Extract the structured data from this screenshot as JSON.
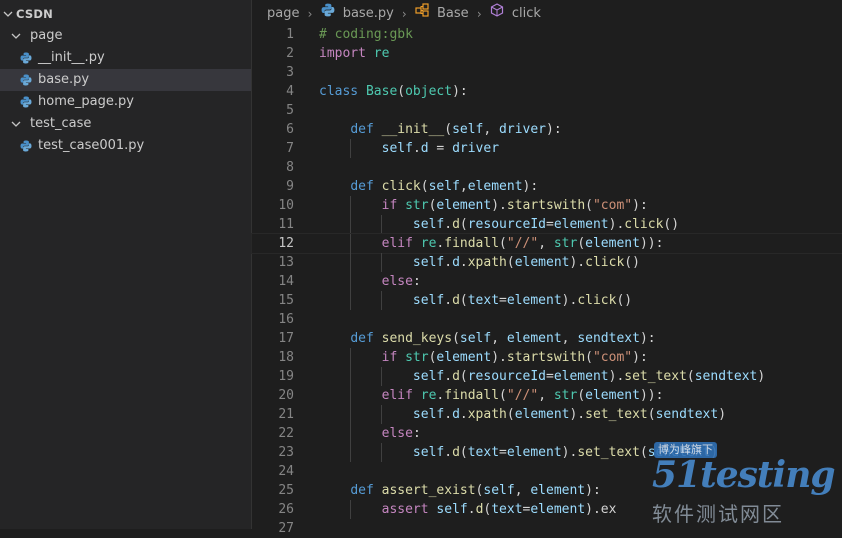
{
  "explorer": {
    "root": "CSDN",
    "items": [
      {
        "label": "page",
        "kind": "folder",
        "depth": 1,
        "expanded": true
      },
      {
        "label": "__init__.py",
        "kind": "python-file",
        "depth": 2
      },
      {
        "label": "base.py",
        "kind": "python-file",
        "depth": 2,
        "selected": true
      },
      {
        "label": "home_page.py",
        "kind": "python-file",
        "depth": 2
      },
      {
        "label": "test_case",
        "kind": "folder",
        "depth": 1,
        "expanded": true
      },
      {
        "label": "test_case001.py",
        "kind": "python-file",
        "depth": 2
      }
    ]
  },
  "breadcrumb": {
    "folder": "page",
    "file": "base.py",
    "class_name": "Base",
    "method": "click"
  },
  "editor": {
    "active_line": 12,
    "lines": [
      {
        "n": "1",
        "indent": 0,
        "tokens": [
          [
            "cmt",
            "# coding:gbk"
          ]
        ]
      },
      {
        "n": "2",
        "indent": 0,
        "tokens": [
          [
            "ctl",
            "import"
          ],
          [
            "plain",
            " "
          ],
          [
            "cls",
            "re"
          ]
        ]
      },
      {
        "n": "3",
        "indent": 0,
        "tokens": []
      },
      {
        "n": "4",
        "indent": 0,
        "tokens": [
          [
            "kw",
            "class"
          ],
          [
            "plain",
            " "
          ],
          [
            "cls",
            "Base"
          ],
          [
            "plain",
            "("
          ],
          [
            "cls",
            "object"
          ],
          [
            "plain",
            "):"
          ]
        ]
      },
      {
        "n": "5",
        "indent": 0,
        "tokens": []
      },
      {
        "n": "6",
        "indent": 1,
        "tokens": [
          [
            "plain",
            "    "
          ],
          [
            "kw",
            "def"
          ],
          [
            "plain",
            " "
          ],
          [
            "fn",
            "__init__"
          ],
          [
            "plain",
            "("
          ],
          [
            "var",
            "self"
          ],
          [
            "plain",
            ", "
          ],
          [
            "var",
            "driver"
          ],
          [
            "plain",
            "):"
          ]
        ]
      },
      {
        "n": "7",
        "indent": 2,
        "tokens": [
          [
            "plain",
            "        "
          ],
          [
            "var",
            "self"
          ],
          [
            "plain",
            "."
          ],
          [
            "var",
            "d"
          ],
          [
            "plain",
            " = "
          ],
          [
            "var",
            "driver"
          ]
        ]
      },
      {
        "n": "8",
        "indent": 0,
        "tokens": []
      },
      {
        "n": "9",
        "indent": 1,
        "tokens": [
          [
            "plain",
            "    "
          ],
          [
            "kw",
            "def"
          ],
          [
            "plain",
            " "
          ],
          [
            "fn",
            "click"
          ],
          [
            "plain",
            "("
          ],
          [
            "var",
            "self"
          ],
          [
            "plain",
            ","
          ],
          [
            "var",
            "element"
          ],
          [
            "plain",
            "):"
          ]
        ]
      },
      {
        "n": "10",
        "indent": 2,
        "tokens": [
          [
            "plain",
            "        "
          ],
          [
            "ctl",
            "if"
          ],
          [
            "plain",
            " "
          ],
          [
            "cls",
            "str"
          ],
          [
            "plain",
            "("
          ],
          [
            "var",
            "element"
          ],
          [
            "plain",
            ")."
          ],
          [
            "fn",
            "startswith"
          ],
          [
            "plain",
            "("
          ],
          [
            "str",
            "\"com\""
          ],
          [
            "plain",
            "):"
          ]
        ]
      },
      {
        "n": "11",
        "indent": 3,
        "tokens": [
          [
            "plain",
            "            "
          ],
          [
            "var",
            "self"
          ],
          [
            "plain",
            "."
          ],
          [
            "fn",
            "d"
          ],
          [
            "plain",
            "("
          ],
          [
            "var",
            "resourceId"
          ],
          [
            "plain",
            "="
          ],
          [
            "var",
            "element"
          ],
          [
            "plain",
            ")."
          ],
          [
            "fn",
            "click"
          ],
          [
            "plain",
            "()"
          ]
        ]
      },
      {
        "n": "12",
        "indent": 2,
        "tokens": [
          [
            "plain",
            "        "
          ],
          [
            "ctl",
            "elif"
          ],
          [
            "plain",
            " "
          ],
          [
            "cls",
            "re"
          ],
          [
            "plain",
            "."
          ],
          [
            "fn",
            "findall"
          ],
          [
            "plain",
            "("
          ],
          [
            "str",
            "\"//\""
          ],
          [
            "plain",
            ", "
          ],
          [
            "cls",
            "str"
          ],
          [
            "plain",
            "("
          ],
          [
            "var",
            "element"
          ],
          [
            "plain",
            ")):"
          ]
        ]
      },
      {
        "n": "13",
        "indent": 3,
        "tokens": [
          [
            "plain",
            "            "
          ],
          [
            "var",
            "self"
          ],
          [
            "plain",
            "."
          ],
          [
            "var",
            "d"
          ],
          [
            "plain",
            "."
          ],
          [
            "fn",
            "xpath"
          ],
          [
            "plain",
            "("
          ],
          [
            "var",
            "element"
          ],
          [
            "plain",
            ")."
          ],
          [
            "fn",
            "click"
          ],
          [
            "plain",
            "()"
          ]
        ]
      },
      {
        "n": "14",
        "indent": 2,
        "tokens": [
          [
            "plain",
            "        "
          ],
          [
            "ctl",
            "else"
          ],
          [
            "plain",
            ":"
          ]
        ]
      },
      {
        "n": "15",
        "indent": 3,
        "tokens": [
          [
            "plain",
            "            "
          ],
          [
            "var",
            "self"
          ],
          [
            "plain",
            "."
          ],
          [
            "fn",
            "d"
          ],
          [
            "plain",
            "("
          ],
          [
            "var",
            "text"
          ],
          [
            "plain",
            "="
          ],
          [
            "var",
            "element"
          ],
          [
            "plain",
            ")."
          ],
          [
            "fn",
            "click"
          ],
          [
            "plain",
            "()"
          ]
        ]
      },
      {
        "n": "16",
        "indent": 0,
        "tokens": []
      },
      {
        "n": "17",
        "indent": 1,
        "tokens": [
          [
            "plain",
            "    "
          ],
          [
            "kw",
            "def"
          ],
          [
            "plain",
            " "
          ],
          [
            "fn",
            "send_keys"
          ],
          [
            "plain",
            "("
          ],
          [
            "var",
            "self"
          ],
          [
            "plain",
            ", "
          ],
          [
            "var",
            "element"
          ],
          [
            "plain",
            ", "
          ],
          [
            "var",
            "sendtext"
          ],
          [
            "plain",
            "):"
          ]
        ]
      },
      {
        "n": "18",
        "indent": 2,
        "tokens": [
          [
            "plain",
            "        "
          ],
          [
            "ctl",
            "if"
          ],
          [
            "plain",
            " "
          ],
          [
            "cls",
            "str"
          ],
          [
            "plain",
            "("
          ],
          [
            "var",
            "element"
          ],
          [
            "plain",
            ")."
          ],
          [
            "fn",
            "startswith"
          ],
          [
            "plain",
            "("
          ],
          [
            "str",
            "\"com\""
          ],
          [
            "plain",
            "):"
          ]
        ]
      },
      {
        "n": "19",
        "indent": 3,
        "tokens": [
          [
            "plain",
            "            "
          ],
          [
            "var",
            "self"
          ],
          [
            "plain",
            "."
          ],
          [
            "fn",
            "d"
          ],
          [
            "plain",
            "("
          ],
          [
            "var",
            "resourceId"
          ],
          [
            "plain",
            "="
          ],
          [
            "var",
            "element"
          ],
          [
            "plain",
            ")."
          ],
          [
            "fn",
            "set_text"
          ],
          [
            "plain",
            "("
          ],
          [
            "var",
            "sendtext"
          ],
          [
            "plain",
            ")"
          ]
        ]
      },
      {
        "n": "20",
        "indent": 2,
        "tokens": [
          [
            "plain",
            "        "
          ],
          [
            "ctl",
            "elif"
          ],
          [
            "plain",
            " "
          ],
          [
            "cls",
            "re"
          ],
          [
            "plain",
            "."
          ],
          [
            "fn",
            "findall"
          ],
          [
            "plain",
            "("
          ],
          [
            "str",
            "\"//\""
          ],
          [
            "plain",
            ", "
          ],
          [
            "cls",
            "str"
          ],
          [
            "plain",
            "("
          ],
          [
            "var",
            "element"
          ],
          [
            "plain",
            ")):"
          ]
        ]
      },
      {
        "n": "21",
        "indent": 3,
        "tokens": [
          [
            "plain",
            "            "
          ],
          [
            "var",
            "self"
          ],
          [
            "plain",
            "."
          ],
          [
            "var",
            "d"
          ],
          [
            "plain",
            "."
          ],
          [
            "fn",
            "xpath"
          ],
          [
            "plain",
            "("
          ],
          [
            "var",
            "element"
          ],
          [
            "plain",
            ")."
          ],
          [
            "fn",
            "set_text"
          ],
          [
            "plain",
            "("
          ],
          [
            "var",
            "sendtext"
          ],
          [
            "plain",
            ")"
          ]
        ]
      },
      {
        "n": "22",
        "indent": 2,
        "tokens": [
          [
            "plain",
            "        "
          ],
          [
            "ctl",
            "else"
          ],
          [
            "plain",
            ":"
          ]
        ]
      },
      {
        "n": "23",
        "indent": 3,
        "tokens": [
          [
            "plain",
            "            "
          ],
          [
            "var",
            "self"
          ],
          [
            "plain",
            "."
          ],
          [
            "fn",
            "d"
          ],
          [
            "plain",
            "("
          ],
          [
            "var",
            "text"
          ],
          [
            "plain",
            "="
          ],
          [
            "var",
            "element"
          ],
          [
            "plain",
            ")."
          ],
          [
            "fn",
            "set_text"
          ],
          [
            "plain",
            "("
          ],
          [
            "var",
            "sendtext"
          ],
          [
            "plain",
            ")"
          ]
        ]
      },
      {
        "n": "24",
        "indent": 0,
        "tokens": []
      },
      {
        "n": "25",
        "indent": 1,
        "tokens": [
          [
            "plain",
            "    "
          ],
          [
            "kw",
            "def"
          ],
          [
            "plain",
            " "
          ],
          [
            "fn",
            "assert_exist"
          ],
          [
            "plain",
            "("
          ],
          [
            "var",
            "self"
          ],
          [
            "plain",
            ", "
          ],
          [
            "var",
            "element"
          ],
          [
            "plain",
            "):"
          ]
        ]
      },
      {
        "n": "26",
        "indent": 2,
        "tokens": [
          [
            "plain",
            "        "
          ],
          [
            "ctl",
            "assert"
          ],
          [
            "plain",
            " "
          ],
          [
            "var",
            "self"
          ],
          [
            "plain",
            "."
          ],
          [
            "fn",
            "d"
          ],
          [
            "plain",
            "("
          ],
          [
            "var",
            "text"
          ],
          [
            "plain",
            "="
          ],
          [
            "var",
            "element"
          ],
          [
            "plain",
            ").ex"
          ]
        ]
      },
      {
        "n": "27",
        "indent": 0,
        "tokens": []
      }
    ]
  },
  "watermark": {
    "badge": "博为峰旗下",
    "logo": "51testing",
    "subtitle": "软件测试网区"
  },
  "colors": {
    "sidebar_bg": "#252526",
    "editor_bg": "#1e1e1e",
    "selection_bg": "#37373d",
    "keyword": "#569cd6",
    "control": "#c586c0",
    "function": "#dcdcaa",
    "class": "#4ec9b0",
    "variable": "#9cdcfe",
    "string": "#ce9178",
    "comment": "#6a9955"
  }
}
